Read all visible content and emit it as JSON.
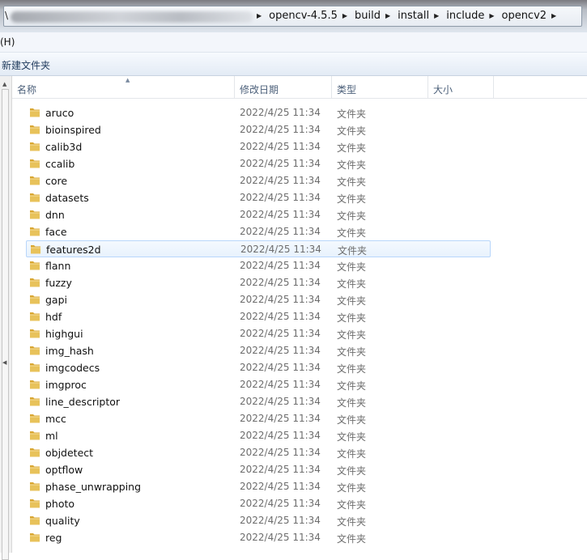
{
  "address": {
    "root": "\\",
    "crumbs": [
      "opencv-4.5.5",
      "build",
      "install",
      "include",
      "opencv2"
    ]
  },
  "menu": {
    "help": "(H)"
  },
  "toolbar": {
    "new_folder": "新建文件夹"
  },
  "columns": {
    "name": "名称",
    "modified": "修改日期",
    "type": "类型",
    "size": "大小"
  },
  "files": [
    {
      "name": "aruco",
      "date": "2022/4/25 11:34",
      "type": "文件夹"
    },
    {
      "name": "bioinspired",
      "date": "2022/4/25 11:34",
      "type": "文件夹"
    },
    {
      "name": "calib3d",
      "date": "2022/4/25 11:34",
      "type": "文件夹"
    },
    {
      "name": "ccalib",
      "date": "2022/4/25 11:34",
      "type": "文件夹"
    },
    {
      "name": "core",
      "date": "2022/4/25 11:34",
      "type": "文件夹"
    },
    {
      "name": "datasets",
      "date": "2022/4/25 11:34",
      "type": "文件夹"
    },
    {
      "name": "dnn",
      "date": "2022/4/25 11:34",
      "type": "文件夹"
    },
    {
      "name": "face",
      "date": "2022/4/25 11:34",
      "type": "文件夹"
    },
    {
      "name": "features2d",
      "date": "2022/4/25 11:34",
      "type": "文件夹",
      "selected": true
    },
    {
      "name": "flann",
      "date": "2022/4/25 11:34",
      "type": "文件夹"
    },
    {
      "name": "fuzzy",
      "date": "2022/4/25 11:34",
      "type": "文件夹"
    },
    {
      "name": "gapi",
      "date": "2022/4/25 11:34",
      "type": "文件夹"
    },
    {
      "name": "hdf",
      "date": "2022/4/25 11:34",
      "type": "文件夹"
    },
    {
      "name": "highgui",
      "date": "2022/4/25 11:34",
      "type": "文件夹"
    },
    {
      "name": "img_hash",
      "date": "2022/4/25 11:34",
      "type": "文件夹"
    },
    {
      "name": "imgcodecs",
      "date": "2022/4/25 11:34",
      "type": "文件夹"
    },
    {
      "name": "imgproc",
      "date": "2022/4/25 11:34",
      "type": "文件夹"
    },
    {
      "name": "line_descriptor",
      "date": "2022/4/25 11:34",
      "type": "文件夹"
    },
    {
      "name": "mcc",
      "date": "2022/4/25 11:34",
      "type": "文件夹"
    },
    {
      "name": "ml",
      "date": "2022/4/25 11:34",
      "type": "文件夹"
    },
    {
      "name": "objdetect",
      "date": "2022/4/25 11:34",
      "type": "文件夹"
    },
    {
      "name": "optflow",
      "date": "2022/4/25 11:34",
      "type": "文件夹"
    },
    {
      "name": "phase_unwrapping",
      "date": "2022/4/25 11:34",
      "type": "文件夹"
    },
    {
      "name": "photo",
      "date": "2022/4/25 11:34",
      "type": "文件夹"
    },
    {
      "name": "quality",
      "date": "2022/4/25 11:34",
      "type": "文件夹"
    },
    {
      "name": "reg",
      "date": "2022/4/25 11:34",
      "type": "文件夹"
    }
  ],
  "icons": {
    "folder": "folder-icon",
    "breadcrumb_separator": "chevron-right-icon",
    "sort": "sort-up-icon"
  },
  "colors": {
    "selection_border": "#b8d6fb",
    "folder": "#e8c25a"
  }
}
